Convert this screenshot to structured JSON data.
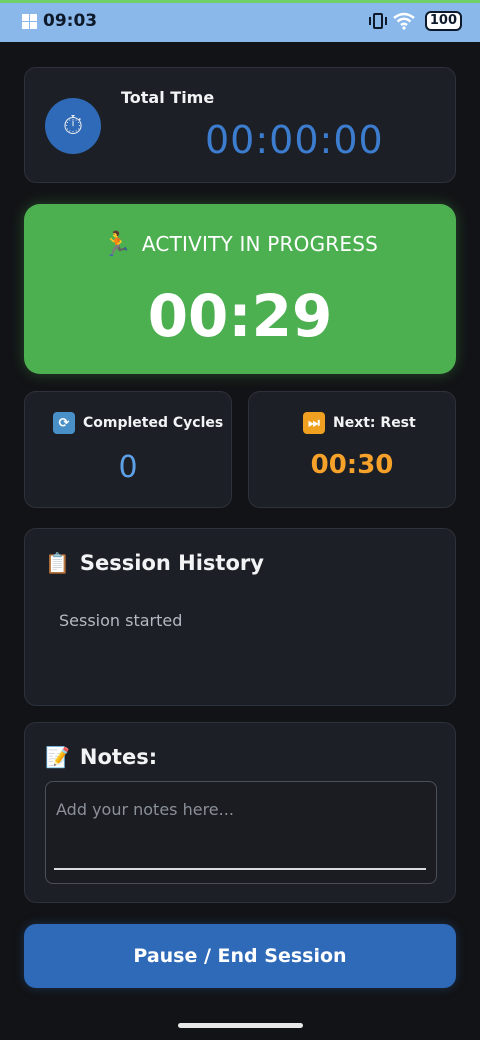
{
  "status_bar": {
    "time": "09:03",
    "battery": "100",
    "icons": [
      "windows-icon",
      "vibrate-icon",
      "wifi-icon",
      "battery-icon"
    ]
  },
  "total_time": {
    "icon": "stopwatch-icon",
    "label": "Total Time",
    "value": "00:00:00"
  },
  "activity": {
    "icon": "runner-icon",
    "label": "ACTIVITY IN PROGRESS",
    "timer": "00:29"
  },
  "cycles": {
    "icon": "repeat-icon",
    "label": "Completed Cycles",
    "value": "0"
  },
  "next": {
    "icon": "fast-forward-icon",
    "label": "Next: Rest",
    "value": "00:30"
  },
  "history": {
    "icon": "clipboard-icon",
    "title": "Session History",
    "entries": [
      "Session started"
    ]
  },
  "notes": {
    "icon": "memo-icon",
    "title": "Notes:",
    "placeholder": "Add your notes here...",
    "value": ""
  },
  "actions": {
    "end_label": "Pause / End Session"
  },
  "colors": {
    "background": "#121316",
    "card": "#1c1f26",
    "activity_green": "#4caf50",
    "accent_blue": "#2f6ab8",
    "total_time_blue": "#3d7dd0",
    "cycles_blue": "#5ea0e8",
    "next_orange": "#f5a12a",
    "status_bar": "#8ab8ea"
  }
}
